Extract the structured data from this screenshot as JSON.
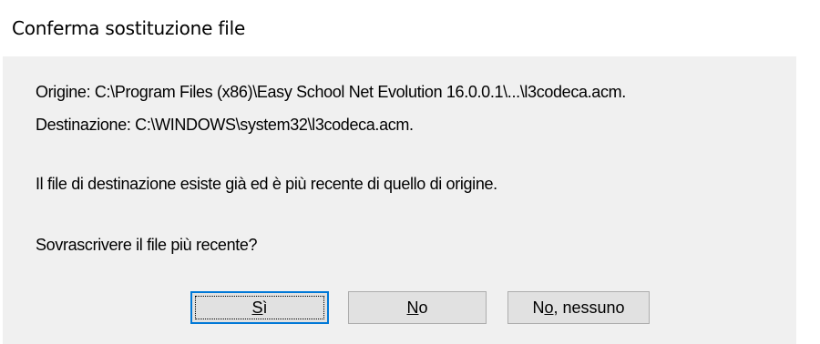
{
  "dialog": {
    "title": "Conferma sostituzione file",
    "origin_line": "Origine: C:\\Program Files (x86)\\Easy School Net Evolution 16.0.0.1\\...\\l3codeca.acm.",
    "destination_line": "Destinazione: C:\\WINDOWS\\system32\\l3codeca.acm.",
    "info_line": "Il file di destinazione esiste già ed è più recente di quello di origine.",
    "question_line": "Sovrascrivere il file più recente?"
  },
  "buttons": {
    "yes": {
      "mnemonic": "S",
      "rest": "ì"
    },
    "no": {
      "mnemonic": "N",
      "rest": "o"
    },
    "no_all": {
      "pre": "N",
      "mnemonic": "o",
      "rest": ", nessuno"
    }
  },
  "colors": {
    "panel_background": "#f0f0f0",
    "button_face": "#e1e1e1",
    "button_border": "#adadad",
    "default_button_accent": "#0078d7"
  }
}
